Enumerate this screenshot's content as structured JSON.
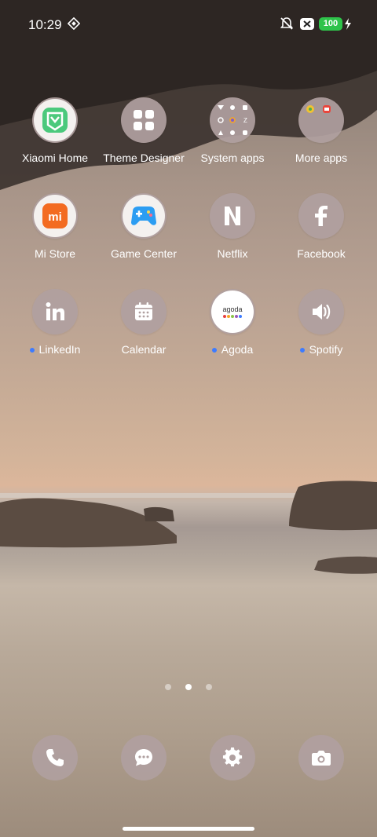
{
  "status": {
    "time": "10:29",
    "battery": "100"
  },
  "apps": [
    {
      "label": "Xiaomi Home",
      "icon": "xiaomi-home-icon",
      "new": false
    },
    {
      "label": "Theme Designer",
      "icon": "theme-designer-icon",
      "new": false
    },
    {
      "label": "System apps",
      "icon": "system-apps-folder-icon",
      "new": false
    },
    {
      "label": "More apps",
      "icon": "more-apps-folder-icon",
      "new": false
    },
    {
      "label": "Mi Store",
      "icon": "mi-store-icon",
      "new": false
    },
    {
      "label": "Game Center",
      "icon": "game-center-icon",
      "new": false
    },
    {
      "label": "Netflix",
      "icon": "netflix-icon",
      "new": false
    },
    {
      "label": "Facebook",
      "icon": "facebook-icon",
      "new": false
    },
    {
      "label": "LinkedIn",
      "icon": "linkedin-icon",
      "new": true
    },
    {
      "label": "Calendar",
      "icon": "calendar-icon",
      "new": false
    },
    {
      "label": "Agoda",
      "icon": "agoda-icon",
      "new": true
    },
    {
      "label": "Spotify",
      "icon": "spotify-icon",
      "new": true
    }
  ],
  "agoda_logo_text": "agoda",
  "mi_store_logo_text": "mi",
  "pages": {
    "count": 3,
    "active": 2
  },
  "dock": [
    {
      "icon": "phone-icon"
    },
    {
      "icon": "messages-icon"
    },
    {
      "icon": "settings-icon"
    },
    {
      "icon": "camera-icon"
    }
  ],
  "colors": {
    "battery": "#2ec34a",
    "new_dot": "#3d7bff",
    "icon_bg": "#b0a0a0"
  }
}
